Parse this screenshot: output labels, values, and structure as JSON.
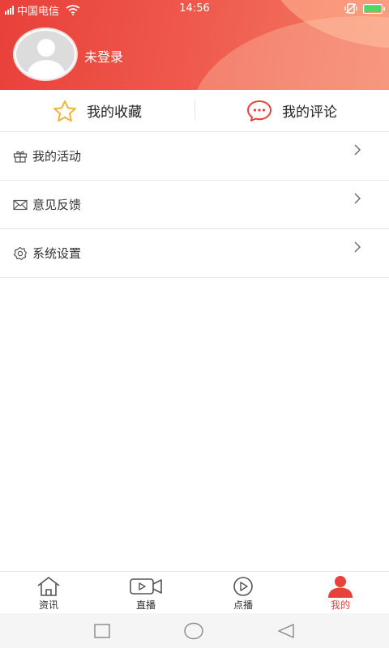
{
  "status_bar": {
    "carrier": "中国电信",
    "time": "14:56"
  },
  "profile": {
    "login_status": "未登录"
  },
  "quick_actions": {
    "favorites_label": "我的收藏",
    "comments_label": "我的评论"
  },
  "menu": {
    "items": [
      {
        "label": "我的活动",
        "icon": "gift-icon"
      },
      {
        "label": "意见反馈",
        "icon": "mail-icon"
      },
      {
        "label": "系统设置",
        "icon": "gear-icon"
      }
    ]
  },
  "tabbar": {
    "active_index": 3,
    "items": [
      {
        "label": "资讯",
        "icon": "home-icon"
      },
      {
        "label": "直播",
        "icon": "video-camera-icon"
      },
      {
        "label": "点播",
        "icon": "play-circle-icon"
      },
      {
        "label": "我的",
        "icon": "user-icon"
      }
    ]
  },
  "colors": {
    "accent": "#e8403a",
    "star": "#f0b43c",
    "battery": "#4cd964"
  }
}
